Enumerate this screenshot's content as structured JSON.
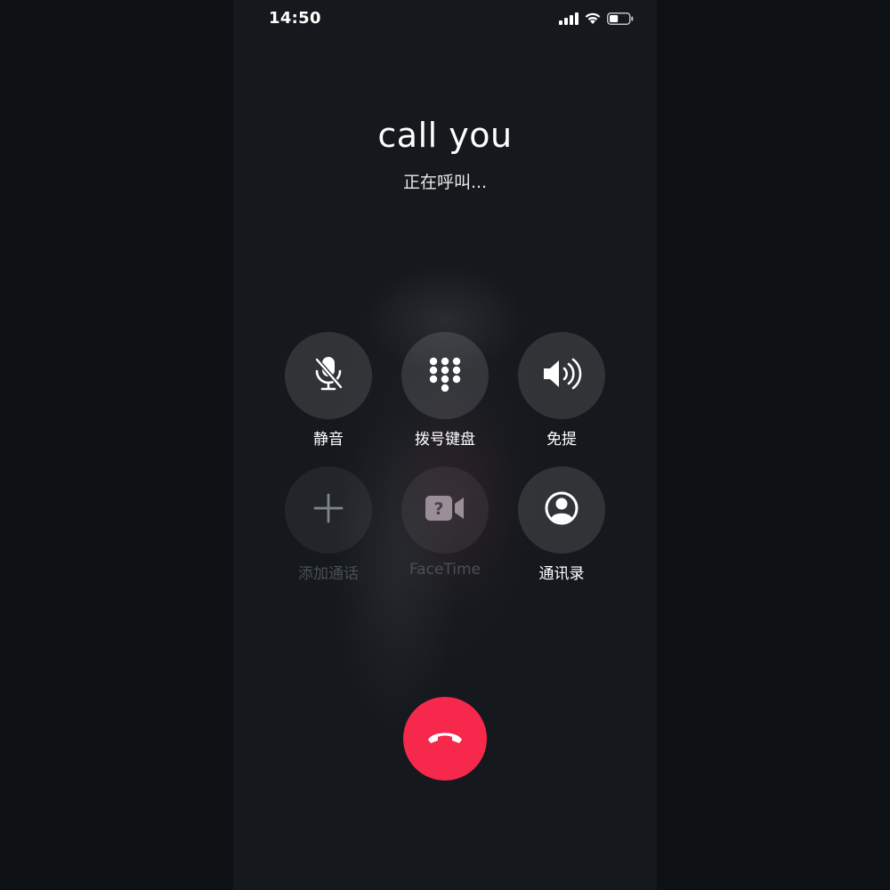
{
  "status_bar": {
    "time": "14:50",
    "signal_icon": "cellular-signal-icon",
    "wifi_icon": "wifi-icon",
    "battery_icon": "battery-icon",
    "battery_level": 0.45
  },
  "call": {
    "name": "call you",
    "status": "正在呼叫..."
  },
  "controls": [
    {
      "label": "静音",
      "icon": "mute-microphone-icon",
      "enabled": true
    },
    {
      "label": "拨号键盘",
      "icon": "keypad-icon",
      "enabled": true
    },
    {
      "label": "免提",
      "icon": "speaker-icon",
      "enabled": true
    },
    {
      "label": "添加通话",
      "icon": "add-call-icon",
      "enabled": false
    },
    {
      "label": "FaceTime",
      "icon": "facetime-video-icon",
      "enabled": false
    },
    {
      "label": "通讯录",
      "icon": "contacts-icon",
      "enabled": true
    }
  ],
  "end_call": {
    "icon": "end-call-icon",
    "color": "#f6284c"
  }
}
